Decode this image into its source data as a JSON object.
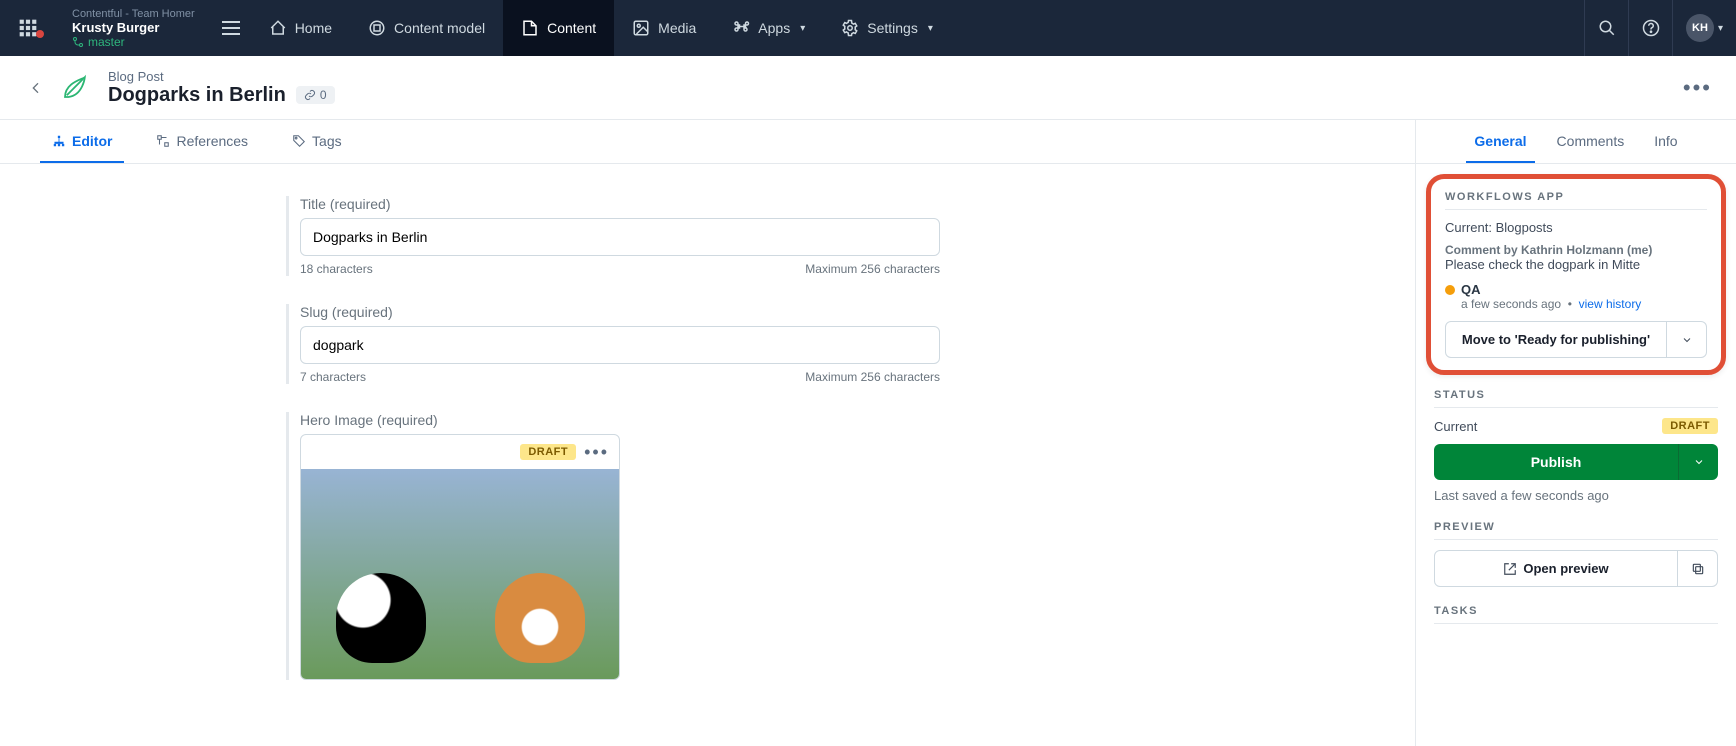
{
  "topbar": {
    "org": "Contentful - Team Homer",
    "space": "Krusty Burger",
    "branch": "master",
    "avatar": "KH",
    "nav": {
      "home": "Home",
      "content_model": "Content model",
      "content": "Content",
      "media": "Media",
      "apps": "Apps",
      "settings": "Settings"
    }
  },
  "header": {
    "content_type": "Blog Post",
    "title": "Dogparks in Berlin",
    "link_count": "0"
  },
  "tabs": {
    "editor": "Editor",
    "references": "References",
    "tags": "Tags"
  },
  "fields": {
    "title_label": "Title (required)",
    "title_value": "Dogparks in Berlin",
    "title_count": "18 characters",
    "title_max": "Maximum 256 characters",
    "slug_label": "Slug (required)",
    "slug_value": "dogpark",
    "slug_count": "7 characters",
    "slug_max": "Maximum 256 characters",
    "hero_label": "Hero Image (required)",
    "hero_badge": "DRAFT"
  },
  "sidebar_tabs": {
    "general": "General",
    "comments": "Comments",
    "info": "Info"
  },
  "workflow": {
    "heading": "WORKFLOWS APP",
    "current": "Current: Blogposts",
    "comment_by": "Comment by Kathrin Holzmann (me)",
    "comment": "Please check the dogpark in Mitte",
    "state": "QA",
    "time": "a few seconds ago",
    "history": "view history",
    "move_label": "Move to 'Ready for publishing'"
  },
  "status": {
    "heading": "STATUS",
    "current_label": "Current",
    "badge": "DRAFT",
    "publish": "Publish",
    "saved": "Last saved a few seconds ago"
  },
  "preview": {
    "heading": "PREVIEW",
    "open": "Open preview"
  },
  "tasks": {
    "heading": "TASKS"
  }
}
